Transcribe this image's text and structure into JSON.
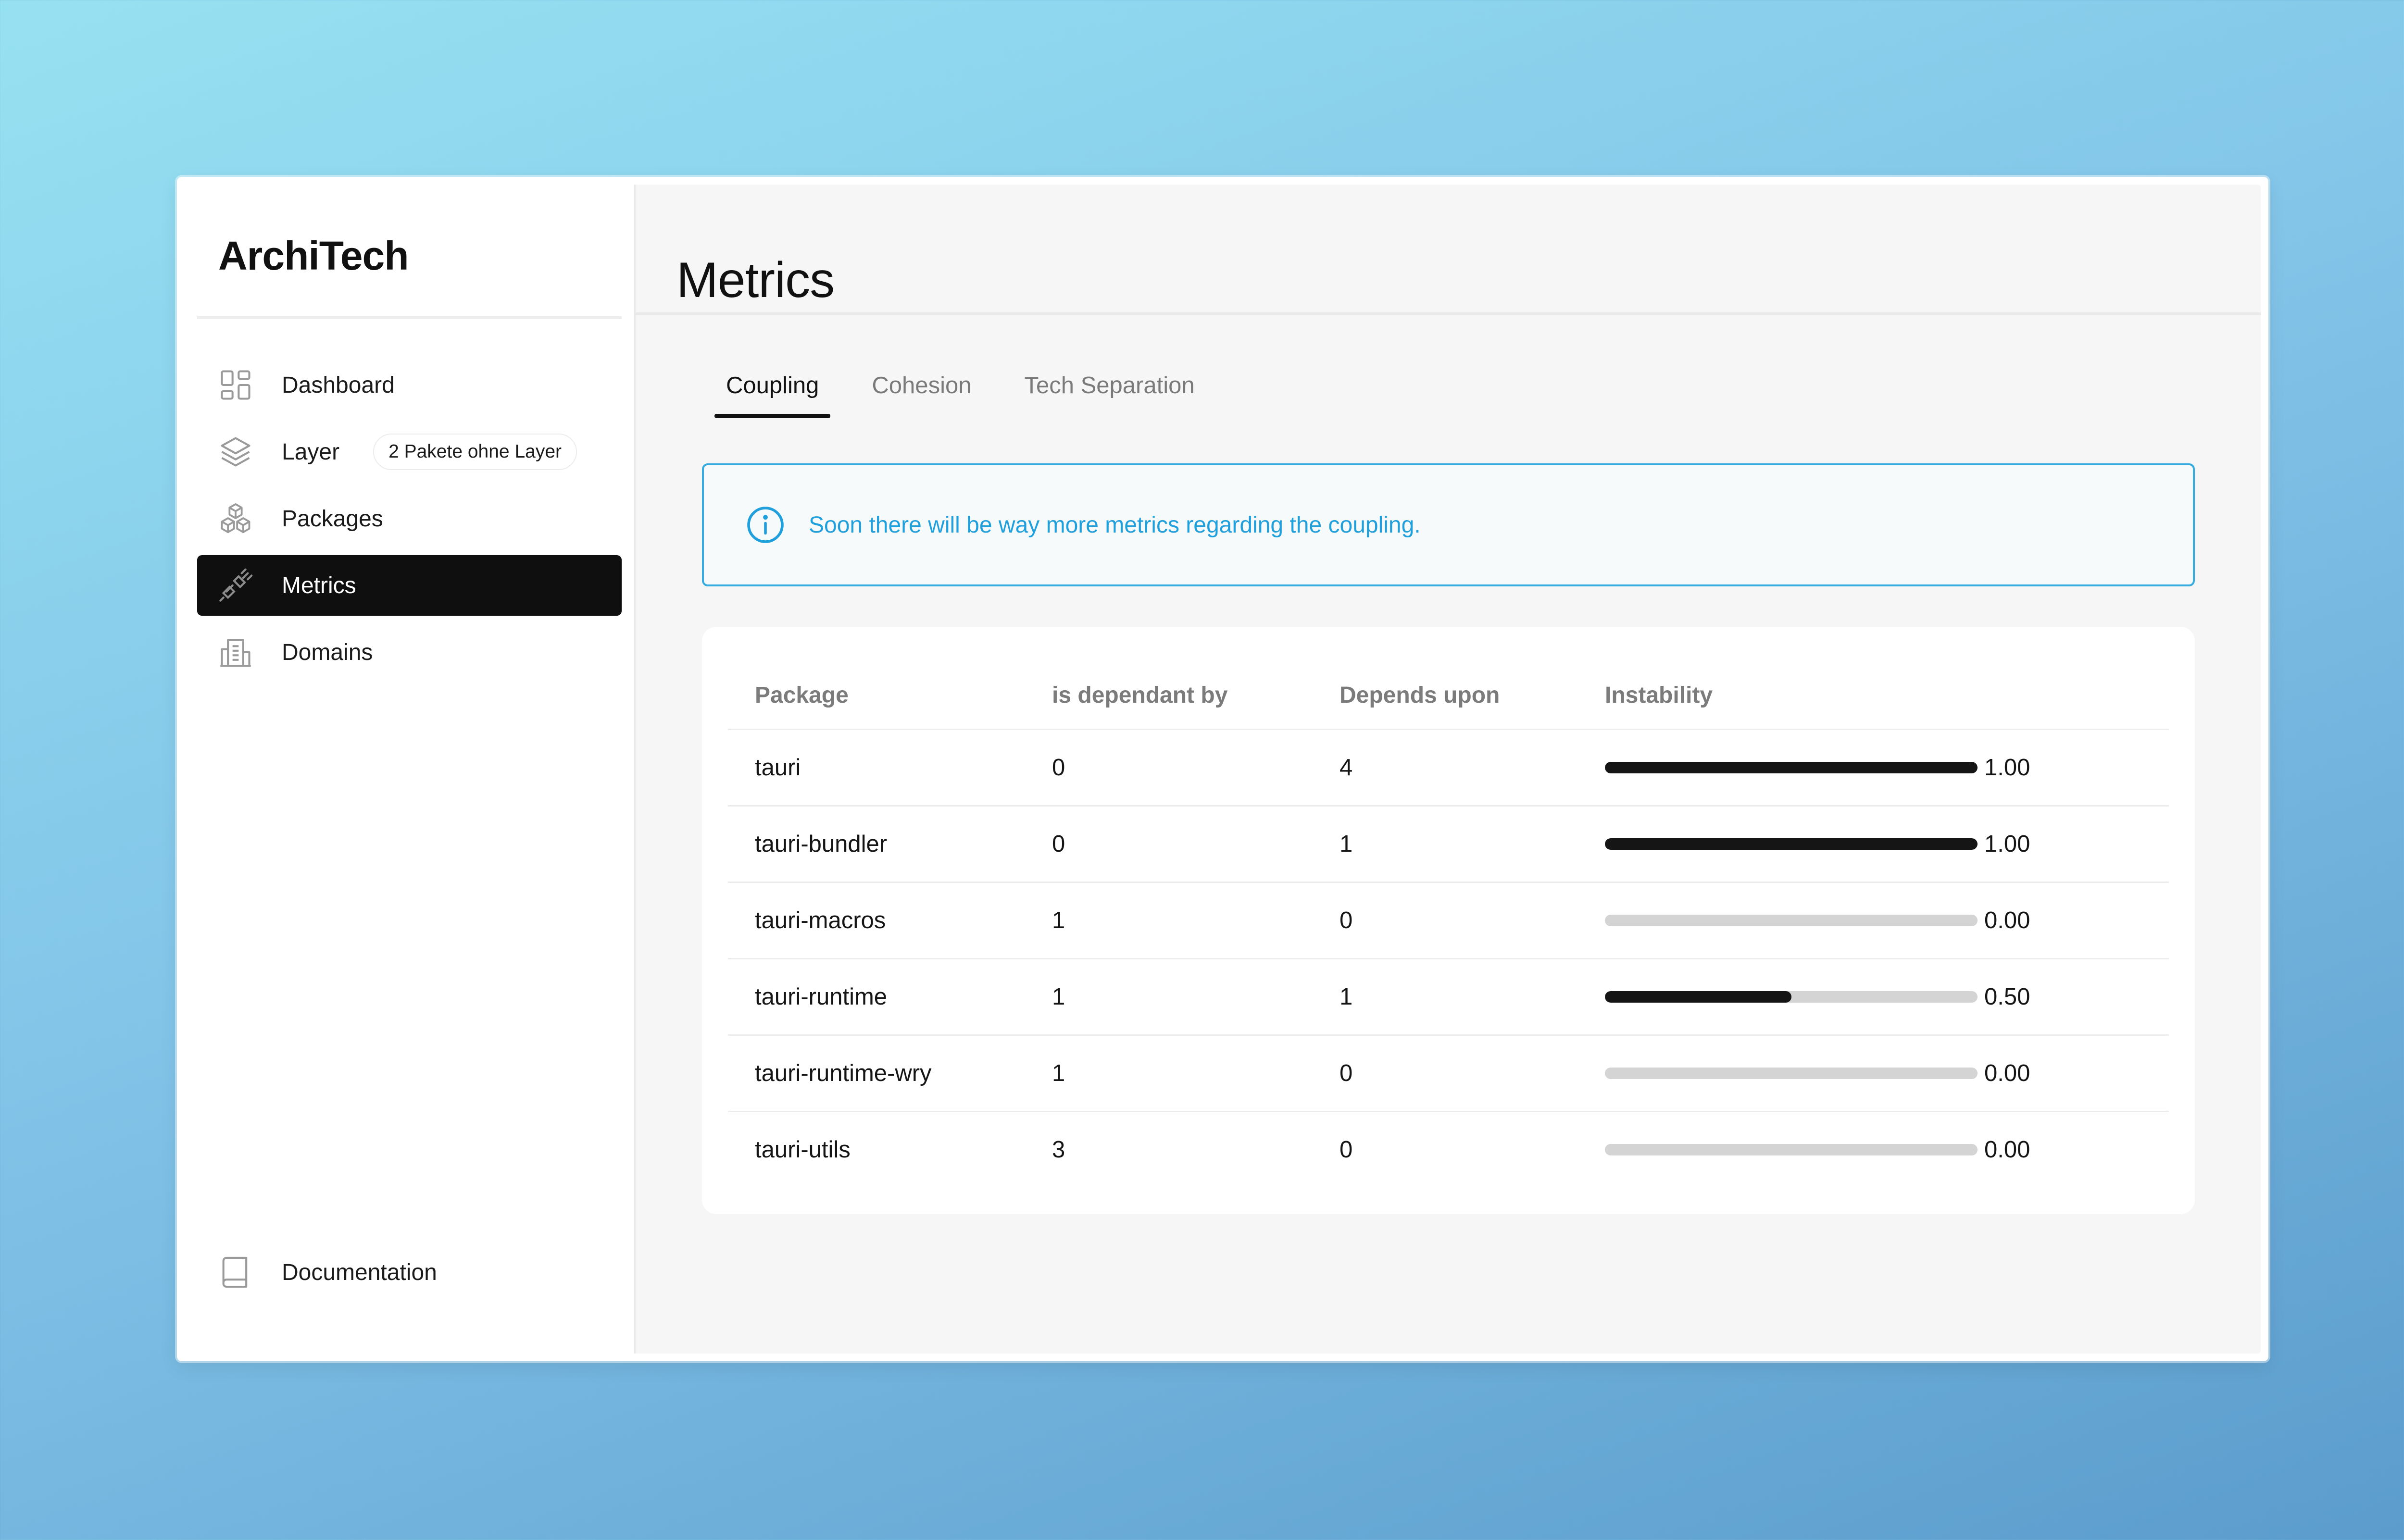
{
  "app": {
    "brand": "ArchiTech"
  },
  "sidebar": {
    "items": [
      {
        "label": "Dashboard",
        "icon": "dashboard-grid-icon",
        "active": false
      },
      {
        "label": "Layer",
        "icon": "layers-icon",
        "active": false,
        "badge": "2 Pakete ohne Layer"
      },
      {
        "label": "Packages",
        "icon": "cubes-icon",
        "active": false
      },
      {
        "label": "Metrics",
        "icon": "plug-icon",
        "active": true
      },
      {
        "label": "Domains",
        "icon": "building-icon",
        "active": false
      }
    ],
    "footer": {
      "label": "Documentation",
      "icon": "book-icon"
    }
  },
  "main": {
    "title": "Metrics",
    "tabs": [
      {
        "label": "Coupling",
        "active": true
      },
      {
        "label": "Cohesion",
        "active": false
      },
      {
        "label": "Tech Separation",
        "active": false
      }
    ],
    "info": {
      "icon": "info-circle-icon",
      "message": "Soon there will be way more metrics regarding the coupling."
    },
    "table": {
      "headers": [
        "Package",
        "is dependant by",
        "Depends upon",
        "Instability"
      ],
      "rows": [
        {
          "package": "tauri",
          "dependant_by": "0",
          "depends_upon": "4",
          "instability": 1.0,
          "instability_label": "1.00"
        },
        {
          "package": "tauri-bundler",
          "dependant_by": "0",
          "depends_upon": "1",
          "instability": 1.0,
          "instability_label": "1.00"
        },
        {
          "package": "tauri-macros",
          "dependant_by": "1",
          "depends_upon": "0",
          "instability": 0.0,
          "instability_label": "0.00"
        },
        {
          "package": "tauri-runtime",
          "dependant_by": "1",
          "depends_upon": "1",
          "instability": 0.5,
          "instability_label": "0.50"
        },
        {
          "package": "tauri-runtime-wry",
          "dependant_by": "1",
          "depends_upon": "0",
          "instability": 0.0,
          "instability_label": "0.00"
        },
        {
          "package": "tauri-utils",
          "dependant_by": "3",
          "depends_upon": "0",
          "instability": 0.0,
          "instability_label": "0.00"
        }
      ]
    }
  },
  "colors": {
    "accent": "#1f9fdc",
    "active_nav": "#0f0f0f",
    "bar_fill": "#151515",
    "bar_track": "#d4d4d4"
  }
}
